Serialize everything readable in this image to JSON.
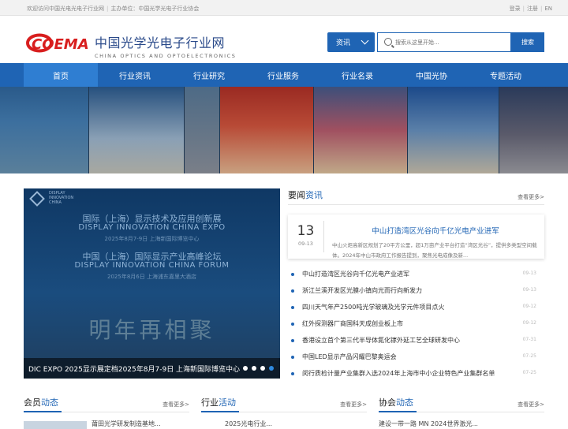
{
  "topbar": {
    "welcome": "欢迎访问中国光电光电子行业网",
    "host": "主办单位：中国光学光电子行业协会",
    "login": "登录",
    "register": "注册",
    "lang": "EN"
  },
  "brand": {
    "logo_text": "COEMA",
    "cn_name": "中国光学光电子行业网",
    "en_name": "CHINA OPTICS AND OPTOELECTRONICS"
  },
  "search": {
    "type_label": "资讯",
    "placeholder": "搜索从这里开始...",
    "button": "搜索"
  },
  "nav": [
    "首页",
    "行业资讯",
    "行业研究",
    "行业服务",
    "行业名录",
    "中国光协",
    "专题活动"
  ],
  "colors": {
    "brand_blue": "#1f64b4",
    "nav_active": "#2f7ed2",
    "logo_red": "#d81e1e"
  },
  "slider": {
    "logo_line1": "DISPLAY",
    "logo_line2": "INNOVATION",
    "logo_line3": "CHINA",
    "expo_cn": "国际（上海）显示技术及应用创新展",
    "expo_en": "DISPLAY INNOVATION CHINA EXPO",
    "expo_date": "2025年8月7-9日  上海新国际博览中心",
    "forum_cn": "中国（上海）国际显示产业高峰论坛",
    "forum_en": "DISPLAY INNOVATION CHINA FORUM",
    "forum_date": "2025年8月6日  上海浦东嘉里大酒店",
    "calligraphy": "明年再相聚",
    "caption": "DIC EXPO 2025显示展定档2025年8月7-9日 上海新国际博览中心"
  },
  "news": {
    "title_a": "要闻",
    "title_b": "资讯",
    "more": "查看更多>",
    "feature": {
      "day": "13",
      "ym": "09-13",
      "title": "中山打造湾区光谷向千亿光电产业进军",
      "summary": "中山火炬高新区规划了20平方公里，超1万亩产业平台打造“湾区光谷”，提供多类型空间载体。2024年中山市政府工作报告提到，聚焦光电成像及新..."
    },
    "items": [
      {
        "title": "中山打造湾区光谷向千亿光电产业进军",
        "date": "09-13"
      },
      {
        "title": "浙江兰溪开发区光膜小镇向光而行向新发力",
        "date": "09-13"
      },
      {
        "title": "四川天气年产2500吨光学玻璃及光学元件项目点火",
        "date": "09-12"
      },
      {
        "title": "红外探测器厂商国科天成创业板上市",
        "date": "09-12"
      },
      {
        "title": "香港设立首个第三代半导体氮化镓外延工艺全球研发中心",
        "date": "07-31"
      },
      {
        "title": "中国LED显示产品闪耀巴黎奥运会",
        "date": "07-25"
      },
      {
        "title": "闵行质检计量产业集群入选2024年上海市中小企业特色产业集群名单",
        "date": "07-25"
      }
    ]
  },
  "sections": [
    {
      "a": "会员",
      "b": "动态",
      "more": "查看更多>",
      "peek": "莆田光学研发制造基地..."
    },
    {
      "a": "行业",
      "b": "活动",
      "more": "查看更多>",
      "peek": "2025光电行业..."
    },
    {
      "a": "协会",
      "b": "动态",
      "more": "查看更多>",
      "peek": "建设一带一路 MN 2024世界激光..."
    }
  ]
}
